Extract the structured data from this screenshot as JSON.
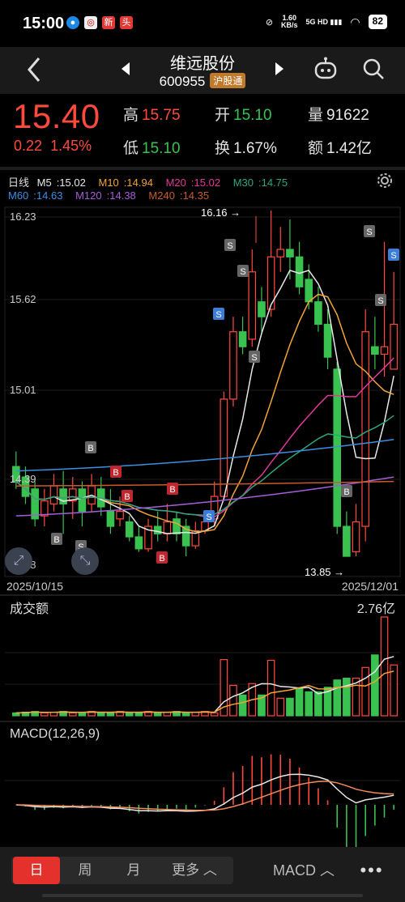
{
  "status": {
    "time": "15:00",
    "net_speed": "1.60\nKB/s",
    "signal": "5G HD",
    "battery": "82"
  },
  "header": {
    "stock_name": "维远股份",
    "stock_code": "600955",
    "badge": "沪股通"
  },
  "quote": {
    "price": "15.40",
    "change": "0.22",
    "change_pct": "1.45%",
    "high_label": "高",
    "high": "15.75",
    "open_label": "开",
    "open": "15.10",
    "volume_label": "量",
    "volume": "91622",
    "low_label": "低",
    "low": "15.10",
    "turnover_label": "换",
    "turnover": "1.67%",
    "amount_label": "额",
    "amount": "1.42亿"
  },
  "kline": {
    "period_label": "日线",
    "ma": [
      {
        "name": "M5",
        "value": "15.02",
        "color": "#e8e8e8"
      },
      {
        "name": "M10",
        "value": "14.94",
        "color": "#f2a33a"
      },
      {
        "name": "M20",
        "value": "15.02",
        "color": "#e2399c"
      },
      {
        "name": "M30",
        "value": "14.75",
        "color": "#2aa87c"
      },
      {
        "name": "M60",
        "value": "14.63",
        "color": "#3c8fe0"
      },
      {
        "name": "M120",
        "value": "14.38",
        "color": "#a45ed8"
      },
      {
        "name": "M240",
        "value": "14.35",
        "color": "#c95a2c"
      }
    ],
    "y_ticks": [
      "16.23",
      "15.62",
      "15.01",
      "14.39",
      "13.78"
    ],
    "date_start": "2025/10/15",
    "date_end": "2025/12/01",
    "max_marker": "16.16",
    "min_marker": "13.85"
  },
  "volume_panel": {
    "title": "成交额",
    "max_label": "2.76亿"
  },
  "macd_panel": {
    "title": "MACD(12,26,9)"
  },
  "chart_data": {
    "type": "candlestick",
    "y_range": [
      13.78,
      16.23
    ],
    "candles": [
      {
        "o": 14.45,
        "c": 14.35,
        "h": 14.55,
        "l": 14.3
      },
      {
        "o": 14.38,
        "c": 14.25,
        "h": 14.45,
        "l": 14.2
      },
      {
        "o": 14.3,
        "c": 14.1,
        "h": 14.35,
        "l": 14.05
      },
      {
        "o": 14.12,
        "c": 14.22,
        "h": 14.3,
        "l": 14.05
      },
      {
        "o": 14.2,
        "c": 14.32,
        "h": 14.4,
        "l": 14.15
      },
      {
        "o": 14.3,
        "c": 14.2,
        "h": 14.42,
        "l": 14.0
      },
      {
        "o": 14.22,
        "c": 14.3,
        "h": 14.38,
        "l": 14.1
      },
      {
        "o": 14.3,
        "c": 14.15,
        "h": 14.35,
        "l": 14.05
      },
      {
        "o": 14.2,
        "c": 14.32,
        "h": 14.4,
        "l": 14.15
      },
      {
        "o": 14.3,
        "c": 14.18,
        "h": 14.38,
        "l": 14.12
      },
      {
        "o": 14.15,
        "c": 14.05,
        "h": 14.3,
        "l": 14.0
      },
      {
        "o": 14.1,
        "c": 14.15,
        "h": 14.25,
        "l": 14.05
      },
      {
        "o": 14.08,
        "c": 13.98,
        "h": 14.12,
        "l": 13.95
      },
      {
        "o": 13.98,
        "c": 13.9,
        "h": 14.05,
        "l": 13.88
      },
      {
        "o": 13.9,
        "c": 14.05,
        "h": 14.1,
        "l": 13.88
      },
      {
        "o": 14.05,
        "c": 14.0,
        "h": 14.15,
        "l": 13.95
      },
      {
        "o": 14.0,
        "c": 14.08,
        "h": 14.2,
        "l": 13.95
      },
      {
        "o": 14.1,
        "c": 14.0,
        "h": 14.15,
        "l": 13.95
      },
      {
        "o": 14.05,
        "c": 13.92,
        "h": 14.1,
        "l": 13.85
      },
      {
        "o": 13.92,
        "c": 14.02,
        "h": 14.08,
        "l": 13.9
      },
      {
        "o": 14.02,
        "c": 14.08,
        "h": 14.15,
        "l": 14.0
      },
      {
        "o": 14.1,
        "c": 14.25,
        "h": 14.35,
        "l": 14.05
      },
      {
        "o": 14.25,
        "c": 14.9,
        "h": 14.95,
        "l": 14.22
      },
      {
        "o": 14.9,
        "c": 15.35,
        "h": 15.45,
        "l": 14.85
      },
      {
        "o": 15.35,
        "c": 15.25,
        "h": 15.45,
        "l": 15.2
      },
      {
        "o": 15.3,
        "c": 15.75,
        "h": 15.9,
        "l": 15.25
      },
      {
        "o": 15.55,
        "c": 15.45,
        "h": 15.65,
        "l": 15.35
      },
      {
        "o": 15.5,
        "c": 15.85,
        "h": 16.16,
        "l": 15.45
      },
      {
        "o": 15.85,
        "c": 15.9,
        "h": 16.05,
        "l": 15.75
      },
      {
        "o": 15.9,
        "c": 15.85,
        "h": 16.1,
        "l": 15.7
      },
      {
        "o": 15.85,
        "c": 15.65,
        "h": 15.95,
        "l": 15.6
      },
      {
        "o": 15.7,
        "c": 15.55,
        "h": 15.8,
        "l": 15.5
      },
      {
        "o": 15.55,
        "c": 15.4,
        "h": 15.65,
        "l": 15.35
      },
      {
        "o": 15.4,
        "c": 15.18,
        "h": 15.5,
        "l": 15.1
      },
      {
        "o": 15.1,
        "c": 14.05,
        "h": 15.15,
        "l": 14.0
      },
      {
        "o": 14.05,
        "c": 13.85,
        "h": 14.15,
        "l": 13.85
      },
      {
        "o": 13.88,
        "c": 14.08,
        "h": 14.2,
        "l": 13.85
      },
      {
        "o": 14.05,
        "c": 15.35,
        "h": 15.5,
        "l": 13.95
      },
      {
        "o": 15.25,
        "c": 15.2,
        "h": 15.45,
        "l": 15.1
      },
      {
        "o": 15.2,
        "c": 15.25,
        "h": 15.95,
        "l": 15.05
      },
      {
        "o": 15.1,
        "c": 15.4,
        "h": 15.75,
        "l": 15.1
      }
    ],
    "volume_max": 2.76
  },
  "tabs": {
    "day": "日",
    "week": "周",
    "month": "月",
    "more": "更多",
    "indicator": "MACD"
  }
}
